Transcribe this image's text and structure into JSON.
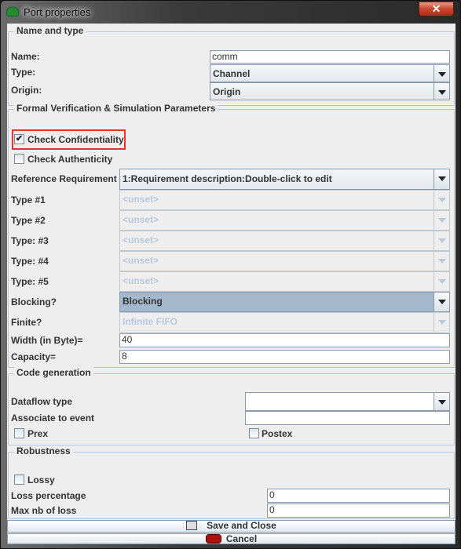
{
  "window": {
    "title": "Port properties",
    "close_label": "✕"
  },
  "name_type": {
    "header": "Name and type",
    "name_label": "Name:",
    "name_value": "comm",
    "type_label": "Type:",
    "type_value": "Channel",
    "origin_label": "Origin:",
    "origin_value": "Origin"
  },
  "formal": {
    "header": "Formal Verification & Simulation Parameters",
    "check_confidentiality": {
      "label": "Check Confidentiality",
      "checked": true
    },
    "check_authenticity": {
      "label": "Check Authenticity",
      "checked": false
    },
    "ref_req_label": "Reference Requirement",
    "ref_req_value": "1:Requirement description:Double-click to edit",
    "types": [
      {
        "label": "Type #1",
        "value": "<unset>"
      },
      {
        "label": "Type #2",
        "value": "<unset>"
      },
      {
        "label": "Type: #3",
        "value": "<unset>"
      },
      {
        "label": "Type: #4",
        "value": "<unset>"
      },
      {
        "label": "Type: #5",
        "value": "<unset>"
      }
    ],
    "blocking_label": "Blocking?",
    "blocking_value": "Blocking",
    "finite_label": "Finite?",
    "finite_value": "Infinite FIFO",
    "width_label": "Width (in Byte)=",
    "width_value": "40",
    "capacity_label": "Capacity=",
    "capacity_value": "8"
  },
  "codegen": {
    "header": "Code generation",
    "dataflow_label": "Dataflow type",
    "dataflow_value": "",
    "assoc_label": "Associate to event",
    "assoc_value": "",
    "prex_label": "Prex",
    "postex_label": "Postex"
  },
  "robustness": {
    "header": "Robustness",
    "lossy_label": "Lossy",
    "loss_pct_label": "Loss percentage",
    "loss_pct_value": "0",
    "max_loss_label": "Max nb of loss",
    "max_loss_value": "0"
  },
  "buttons": {
    "save": "Save and Close",
    "cancel": "Cancel"
  },
  "colors": {
    "highlight": "#e53333",
    "selected": "#a3b8cc"
  }
}
